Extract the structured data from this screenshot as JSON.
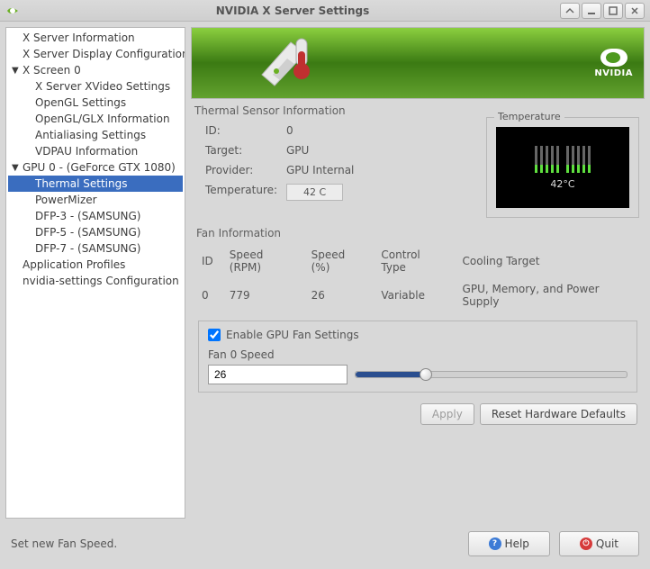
{
  "window": {
    "title": "NVIDIA X Server Settings"
  },
  "sidebar": {
    "items": [
      {
        "label": "X Server Information",
        "level": 0
      },
      {
        "label": "X Server Display Configuration",
        "level": 0
      },
      {
        "label": "X Screen 0",
        "level": 0,
        "expandable": true,
        "expanded": true
      },
      {
        "label": "X Server XVideo Settings",
        "level": 1
      },
      {
        "label": "OpenGL Settings",
        "level": 1
      },
      {
        "label": "OpenGL/GLX Information",
        "level": 1
      },
      {
        "label": "Antialiasing Settings",
        "level": 1
      },
      {
        "label": "VDPAU Information",
        "level": 1
      },
      {
        "label": "GPU 0 - (GeForce GTX 1080)",
        "level": 0,
        "expandable": true,
        "expanded": true
      },
      {
        "label": "Thermal Settings",
        "level": 1,
        "selected": true
      },
      {
        "label": "PowerMizer",
        "level": 1
      },
      {
        "label": "DFP-3 - (SAMSUNG)",
        "level": 1
      },
      {
        "label": "DFP-5 - (SAMSUNG)",
        "level": 1
      },
      {
        "label": "DFP-7 - (SAMSUNG)",
        "level": 1
      },
      {
        "label": "Application Profiles",
        "level": 0
      },
      {
        "label": "nvidia-settings Configuration",
        "level": 0
      }
    ]
  },
  "thermal": {
    "section_title": "Thermal Sensor Information",
    "id_label": "ID:",
    "id_value": "0",
    "target_label": "Target:",
    "target_value": "GPU",
    "provider_label": "Provider:",
    "provider_value": "GPU Internal",
    "temp_label": "Temperature:",
    "temp_badge": "42 C",
    "temperature_box_label": "Temperature",
    "temp_display": "42°C"
  },
  "fan": {
    "section_title": "Fan Information",
    "headers": {
      "id": "ID",
      "rpm": "Speed (RPM)",
      "pct": "Speed (%)",
      "ctrl": "Control Type",
      "target": "Cooling Target"
    },
    "row": {
      "id": "0",
      "rpm": "779",
      "pct": "26",
      "ctrl": "Variable",
      "target": "GPU, Memory, and Power Supply"
    },
    "enable_label": "Enable GPU Fan Settings",
    "enable_checked": true,
    "fan_speed_label": "Fan 0 Speed",
    "fan_speed_value": "26",
    "fan_speed_percent": 26
  },
  "buttons": {
    "apply": "Apply",
    "reset": "Reset Hardware Defaults",
    "help": "Help",
    "quit": "Quit"
  },
  "status": "Set new Fan Speed.",
  "banner": {
    "logo_text": "NVIDIA"
  }
}
